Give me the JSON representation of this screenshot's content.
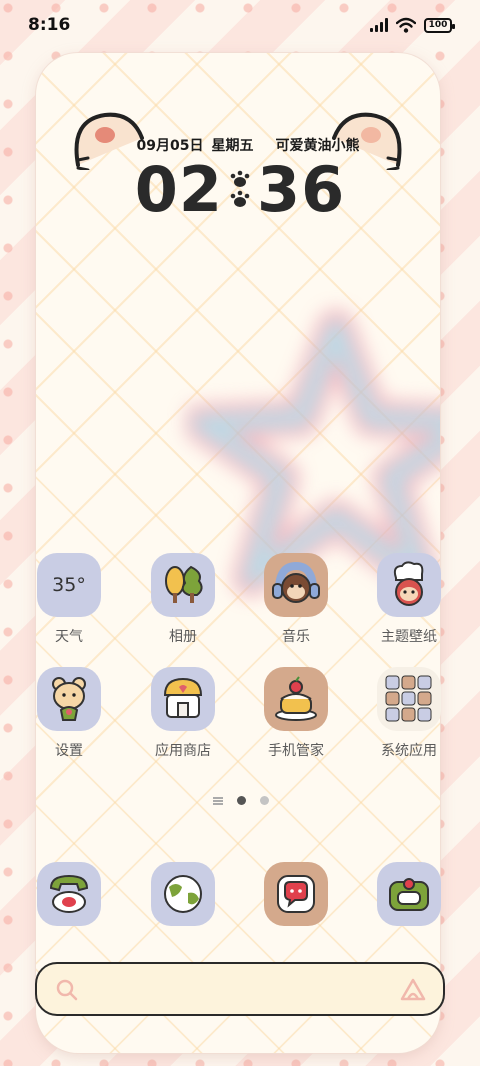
{
  "status_bar": {
    "time": "8:16",
    "battery": "100",
    "icons": [
      "signal-icon",
      "wifi-icon",
      "battery-icon"
    ]
  },
  "clock_widget": {
    "date": "09月05日",
    "weekday": "星期五",
    "caption": "可爱黄油小熊",
    "hour": "02",
    "minute": "36"
  },
  "apps_row1": [
    {
      "label": "天气",
      "icon": "weather-icon",
      "value": "35°"
    },
    {
      "label": "相册",
      "icon": "gallery-trees-icon"
    },
    {
      "label": "音乐",
      "icon": "music-headphone-monkey-icon"
    },
    {
      "label": "主题壁纸",
      "icon": "themes-chef-icon"
    }
  ],
  "apps_row2": [
    {
      "label": "设置",
      "icon": "settings-bear-icon"
    },
    {
      "label": "应用商店",
      "icon": "app-store-house-icon"
    },
    {
      "label": "手机管家",
      "icon": "security-cake-icon"
    },
    {
      "label": "系统应用",
      "icon": "system-apps-folder-icon"
    }
  ],
  "pager": {
    "pages": 2,
    "current": 1
  },
  "dock": [
    {
      "icon": "phone-icon"
    },
    {
      "icon": "browser-globe-icon"
    },
    {
      "icon": "messages-icon"
    },
    {
      "icon": "camera-icon"
    }
  ],
  "search": {
    "icons": [
      "search-icon",
      "assistant-icon"
    ]
  },
  "colors": {
    "icon_bg": "#c9cde4",
    "icon_bg_brown": "#d4a98c",
    "search_bg": "#fdf3dc",
    "text": "#5b5b5b"
  }
}
